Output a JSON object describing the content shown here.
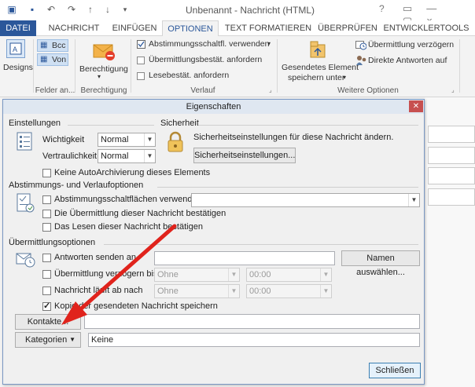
{
  "window": {
    "title": "Unbenannt - Nachricht (HTML)",
    "help": "?"
  },
  "tabs": [
    {
      "label": "DATEI"
    },
    {
      "label": "NACHRICHT"
    },
    {
      "label": "EINFÜGEN"
    },
    {
      "label": "OPTIONEN"
    },
    {
      "label": "TEXT FORMATIEREN"
    },
    {
      "label": "ÜBERPRÜFEN"
    },
    {
      "label": "ENTWICKLERTOOLS"
    }
  ],
  "ribbon": {
    "designs": "Designs",
    "bcc": "Bcc",
    "von": "Von",
    "felder_an": "Felder an...",
    "berechtigung_btn": "Berechtigung",
    "berechtigung_grp": "Berechtigung",
    "abstimmung": "Abstimmungsschaltfl. verwenden",
    "uebermittlung_best": "Übermittlungsbestät. anfordern",
    "lesebest": "Lesebestät. anfordern",
    "verlauf": "Verlauf",
    "gesendetes_line1": "Gesendetes Element",
    "gesendetes_line2": "speichern unter",
    "uebermittlung_verz": "Übermittlung verzögern",
    "direkte_antworten": "Direkte Antworten auf",
    "weitere_optionen": "Weitere Optionen"
  },
  "dialog": {
    "title": "Eigenschaften",
    "einstellungen": "Einstellungen",
    "wichtigkeit_label": "Wichtigkeit",
    "wichtigkeit_value": "Normal",
    "vertraulichkeit_label": "Vertraulichkeit",
    "vertraulichkeit_value": "Normal",
    "sicherheit": "Sicherheit",
    "sicherheit_text": "Sicherheitseinstellungen für diese Nachricht ändern.",
    "sicherheit_btn": "Sicherheitseinstellungen...",
    "auto_archiv": "Keine AutoArchivierung dieses Elements",
    "abstimmung_section": "Abstimmungs- und Verlaufoptionen",
    "abstimmung_cb": "Abstimmungsschaltflächen verwenden",
    "uebermittlung_bestaetigen": "Die Übermittlung dieser Nachricht bestätigen",
    "lesen_bestaetigen": "Das Lesen dieser Nachricht bestätigen",
    "uebermittlungsoptionen": "Übermittlungsoptionen",
    "antworten_an": "Antworten senden an",
    "namen_btn": "Namen auswählen...",
    "verzoegern": "Übermittlung verzögern bis",
    "verzoegern_date": "Ohne",
    "verzoegern_time": "00:00",
    "ablauf": "Nachricht läuft ab nach",
    "ablauf_date": "Ohne",
    "ablauf_time": "00:00",
    "kopie": "Kopie der gesendeten Nachricht speichern",
    "kontakte_btn": "Kontakte...",
    "kategorien_btn": "Kategorien",
    "kategorien_value": "Keine",
    "schliessen": "Schließen"
  },
  "colors": {
    "accent": "#2b579a",
    "arrow": "#e0231c"
  }
}
